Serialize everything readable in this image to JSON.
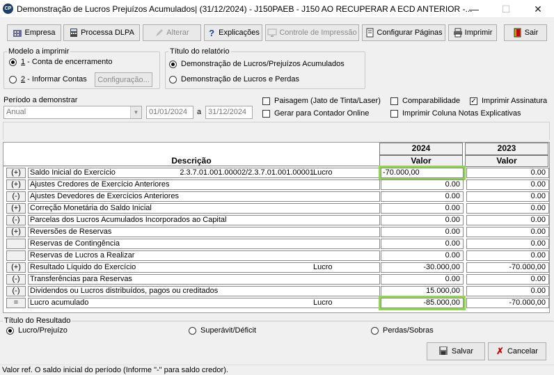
{
  "window": {
    "title": "Demonstração de Lucros Prejuízos Acumulados| (31/12/2024) - J150PAEB - J150 AO RECUPERAR A ECD ANTERIOR  -...",
    "icon_text": "CP",
    "minimize": "—",
    "maximize": "☐",
    "close": "✕"
  },
  "toolbar": {
    "empresa": "Empresa",
    "processa": "Processa DLPA",
    "alterar": "Alterar",
    "explicacoes": "Explicações",
    "controle": "Controle de Impressão",
    "configurar": "Configurar Páginas",
    "imprimir": "Imprimir",
    "sair": "Sair"
  },
  "modelo": {
    "legend": "Modelo a imprimir",
    "opt1_num": "1",
    "opt1": " - Conta de encerramento",
    "opt2_num": "2",
    "opt2": " - Informar Contas",
    "config_button": "Configuração..."
  },
  "titulo_relatorio": {
    "legend": "Título do relatório",
    "opt1": "Demonstração de Lucros/Prejuízos Acumulados",
    "opt2": "Demonstração de Lucros e Perdas"
  },
  "periodo": {
    "label": "Período a demonstrar",
    "select_value": "Anual",
    "start": "01/01/2024",
    "sep": "a",
    "end": "31/12/2024"
  },
  "checks": {
    "paisagem": "Paisagem (Jato de Tinta/Laser)",
    "gerar": "Gerar para Contador Online",
    "comparabilidade": "Comparabilidade",
    "coluna_notas": "Imprimir Coluna Notas Explicativas",
    "assinatura": "Imprimir Assinatura"
  },
  "grid": {
    "desc_header": "Descrição",
    "year1": "2024",
    "year2": "2023",
    "valor": "Valor",
    "rows": [
      {
        "sign": "(+)",
        "desc": "Saldo Inicial do Exercício",
        "acct": "2.3.7.01.001.00002/2.3.7.01.001.00001",
        "tipo": "Lucro",
        "v1": "-70.000,00",
        "v2": "0.00"
      },
      {
        "sign": "(+)",
        "desc": "Ajustes Credores de Exercício Anteriores",
        "acct": "",
        "tipo": "",
        "v1": "0.00",
        "v2": "0.00"
      },
      {
        "sign": "(-)",
        "desc": "Ajustes Devedores de Exercícios Anteriores",
        "acct": "",
        "tipo": "",
        "v1": "0.00",
        "v2": "0.00"
      },
      {
        "sign": "(+)",
        "desc": "Correção Monetária do Saldo Inicial",
        "acct": "",
        "tipo": "",
        "v1": "0.00",
        "v2": "0.00"
      },
      {
        "sign": "(-)",
        "desc": "Parcelas dos Lucros Acumulados Incorporados ao Capital",
        "acct": "",
        "tipo": "",
        "v1": "0.00",
        "v2": "0.00"
      },
      {
        "sign": "(+)",
        "desc": "Reversões de Reservas",
        "acct": "",
        "tipo": "",
        "v1": "0.00",
        "v2": "0.00"
      },
      {
        "sign": "",
        "desc": "Reservas de Contingência",
        "acct": "",
        "tipo": "",
        "v1": "0.00",
        "v2": "0.00"
      },
      {
        "sign": "",
        "desc": "Reservas de Lucros a Realizar",
        "acct": "",
        "tipo": "",
        "v1": "0.00",
        "v2": "0.00"
      },
      {
        "sign": "(+)",
        "desc": "Resultado Líquido do Exercício",
        "acct": "",
        "tipo": "Lucro",
        "v1": "-30.000,00",
        "v2": "-70.000,00"
      },
      {
        "sign": "(-)",
        "desc": "Transferências para Reservas",
        "acct": "",
        "tipo": "",
        "v1": "0.00",
        "v2": "0.00"
      },
      {
        "sign": "(-)",
        "desc": "Dividendos ou Lucros distribuídos, pagos ou creditados",
        "acct": "",
        "tipo": "",
        "v1": "15.000,00",
        "v2": "0.00"
      },
      {
        "sign": "=",
        "desc": "Lucro acumulado",
        "acct": "",
        "tipo": "Lucro",
        "v1": "-85.000,00",
        "v2": "-70.000,00"
      }
    ]
  },
  "resultado": {
    "legend": "Título do Resultado",
    "opt1": "Lucro/Prejuízo",
    "opt2": "Superávit/Déficit",
    "opt3": "Perdas/Sobras"
  },
  "actions": {
    "salvar": "Salvar",
    "cancelar": "Cancelar"
  },
  "status": "Valor ref. O saldo inicial do período (Informe \"-\" para saldo credor).",
  "colors": {
    "highlight": "#8ed94a",
    "titlebar": "#ffffff",
    "background": "#f0f0f0"
  }
}
